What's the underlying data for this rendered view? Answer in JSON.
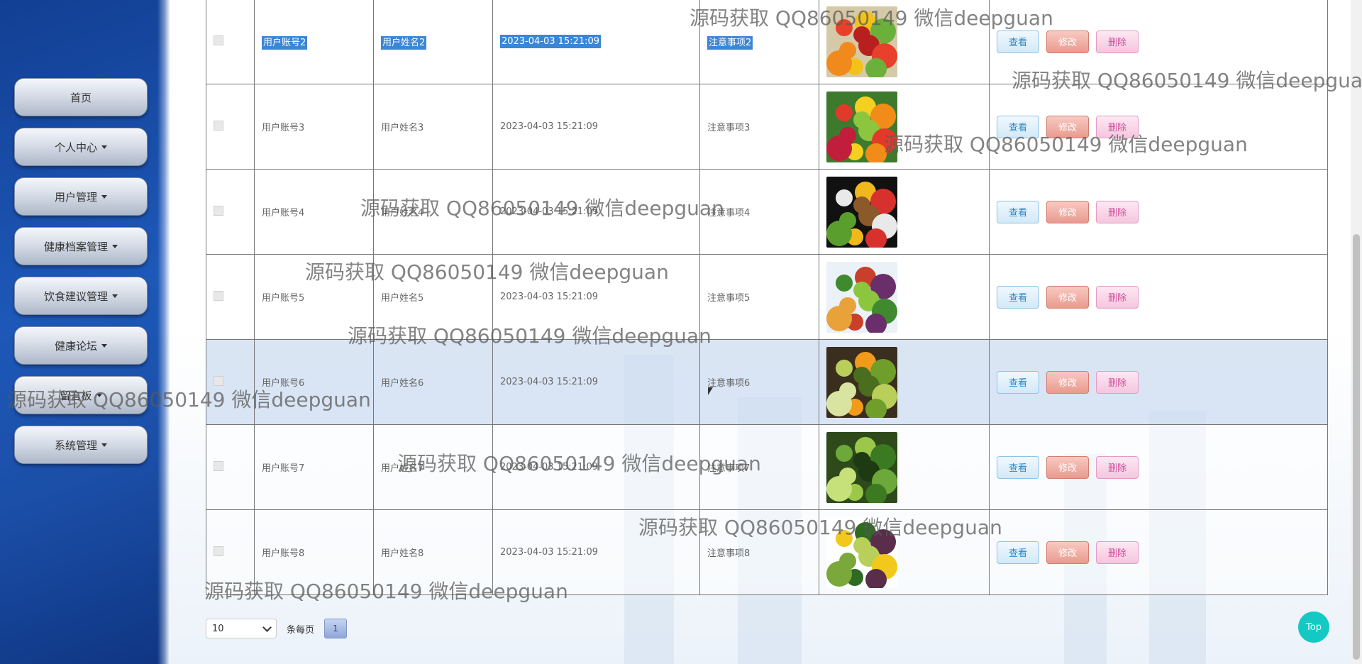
{
  "sidebar": {
    "items": [
      {
        "label": "首页",
        "has_caret": false
      },
      {
        "label": "个人中心",
        "has_caret": true
      },
      {
        "label": "用户管理",
        "has_caret": true
      },
      {
        "label": "健康档案管理",
        "has_caret": true
      },
      {
        "label": "饮食建议管理",
        "has_caret": true
      },
      {
        "label": "健康论坛",
        "has_caret": true
      },
      {
        "label": "留言板",
        "has_caret": true
      },
      {
        "label": "系统管理",
        "has_caret": true
      }
    ]
  },
  "table": {
    "rows": [
      {
        "account": "用户账号2",
        "name": "用户姓名2",
        "time": "2023-04-03 15:21:09",
        "note": "注意事项2",
        "image": "fruit-pile",
        "selected_text": true
      },
      {
        "account": "用户账号3",
        "name": "用户姓名3",
        "time": "2023-04-03 15:21:09",
        "note": "注意事项3",
        "image": "fruit-rows"
      },
      {
        "account": "用户账号4",
        "name": "用户姓名4",
        "time": "2023-04-03 15:21:09",
        "note": "注意事项4",
        "image": "fruit-basket"
      },
      {
        "account": "用户账号5",
        "name": "用户姓名5",
        "time": "2023-04-03 15:21:09",
        "note": "注意事项5",
        "image": "mixed-produce"
      },
      {
        "account": "用户账号6",
        "name": "用户姓名6",
        "time": "2023-04-03 15:21:09",
        "note": "注意事项6",
        "image": "green-smoothie",
        "highlight": true
      },
      {
        "account": "用户账号7",
        "name": "用户姓名7",
        "time": "2023-04-03 15:21:09",
        "note": "注意事项7",
        "image": "green-vegetables"
      },
      {
        "account": "用户账号8",
        "name": "用户姓名8",
        "time": "2023-04-03 15:21:09",
        "note": "注意事项8",
        "image": "pepper-greens"
      }
    ],
    "actions": {
      "view": "查看",
      "edit": "修改",
      "delete": "删除"
    }
  },
  "pager": {
    "page_size": "10",
    "per_page_label": "条每页",
    "current_page": "1"
  },
  "top_button": "Top",
  "watermark": "源码获取 QQ86050149 微信deepguan",
  "colors": {
    "sidebar": "#1d58b8",
    "edit_button": "#e99a8e",
    "top_button": "#14c9c4",
    "highlight_row": "#cddcf0"
  }
}
